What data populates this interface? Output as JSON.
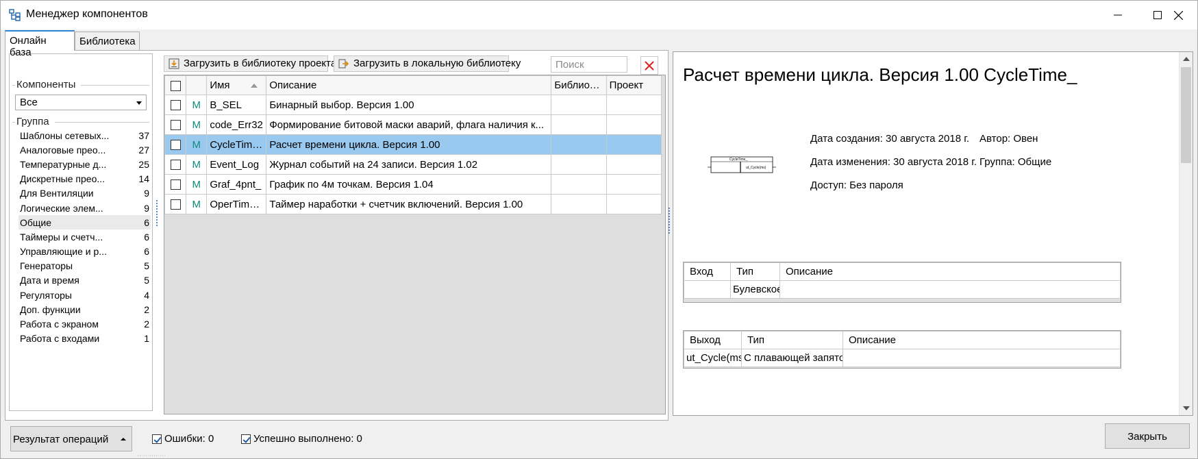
{
  "window": {
    "title": "Менеджер компонентов",
    "icon": "component-manager-icon"
  },
  "tabs": [
    {
      "label": "Онлайн база",
      "active": true
    },
    {
      "label": "Библиотека",
      "active": false
    }
  ],
  "components_filter": {
    "legend": "Компоненты",
    "selected": "Все"
  },
  "groups": {
    "legend": "Группа",
    "items": [
      {
        "label": "Шаблоны сетевых...",
        "count": "37"
      },
      {
        "label": "Аналоговые прео...",
        "count": "27"
      },
      {
        "label": "Температурные д...",
        "count": "25"
      },
      {
        "label": "Дискретные прео...",
        "count": "14"
      },
      {
        "label": "Для Вентиляции",
        "count": "9"
      },
      {
        "label": "Логические элем...",
        "count": "9"
      },
      {
        "label": "Общие",
        "count": "6",
        "selected": true
      },
      {
        "label": "Таймеры и счетч...",
        "count": "6"
      },
      {
        "label": "Управляющие и р...",
        "count": "6"
      },
      {
        "label": "Генераторы",
        "count": "5"
      },
      {
        "label": "Дата и время",
        "count": "5"
      },
      {
        "label": "Регуляторы",
        "count": "4"
      },
      {
        "label": "Доп. функции",
        "count": "2"
      },
      {
        "label": "Работа с экраном",
        "count": "2"
      },
      {
        "label": "Работа с входами",
        "count": "1"
      }
    ]
  },
  "toolbar": {
    "load_project_label": "Загрузить в библиотеку проекта",
    "load_local_label": "Загрузить в локальную библиотеку",
    "search_placeholder": "Поиск"
  },
  "grid": {
    "columns": [
      "",
      "",
      "Имя",
      "Описание",
      "Библиотек",
      "Проект"
    ],
    "rows": [
      {
        "m": "M",
        "name": "B_SEL",
        "desc": "Бинарный выбор. Версия 1.00",
        "lib": "",
        "proj": ""
      },
      {
        "m": "M",
        "name": "code_Err32",
        "desc": "Формирование битовой маски аварий, флага наличия к...",
        "lib": "",
        "proj": ""
      },
      {
        "m": "M",
        "name": "CycleTime_",
        "desc": "Расчет времени цикла. Версия 1.00",
        "lib": "",
        "proj": "",
        "selected": true
      },
      {
        "m": "M",
        "name": "Event_Log",
        "desc": "Журнал событий на 24 записи. Версия 1.02",
        "lib": "",
        "proj": ""
      },
      {
        "m": "M",
        "name": "Graf_4pnt_",
        "desc": "График по 4м точкам. Версия 1.04",
        "lib": "",
        "proj": ""
      },
      {
        "m": "M",
        "name": "OperTimer_",
        "desc": "Таймер наработки + счетчик включений. Версия 1.00",
        "lib": "",
        "proj": ""
      }
    ]
  },
  "detail": {
    "title": "Расчет времени цикла. Версия 1.00 CycleTime_",
    "block_name": "CycleTime_",
    "block_output": "ut_Cycle(ms)",
    "created": "Дата создания: 30 августа 2018 г.",
    "modified": "Дата изменения: 30 августа 2018 г.",
    "access": "Доступ: Без пароля",
    "author": "Автор: Овен",
    "group": "Группа: Общие",
    "inputs": {
      "columns": [
        "Вход",
        "Тип",
        "Описание"
      ],
      "rows": [
        [
          "",
          "Булевское",
          ""
        ]
      ]
    },
    "outputs": {
      "columns": [
        "Выход",
        "Тип",
        "Описание"
      ],
      "rows": [
        [
          "ut_Cycle(ms)",
          "С плавающей запятой",
          ""
        ]
      ]
    }
  },
  "bottom": {
    "result_label": "Результат операций",
    "errors_label": "Ошибки: 0",
    "success_label": "Успешно выполнено: 0",
    "close_label": "Закрыть"
  }
}
